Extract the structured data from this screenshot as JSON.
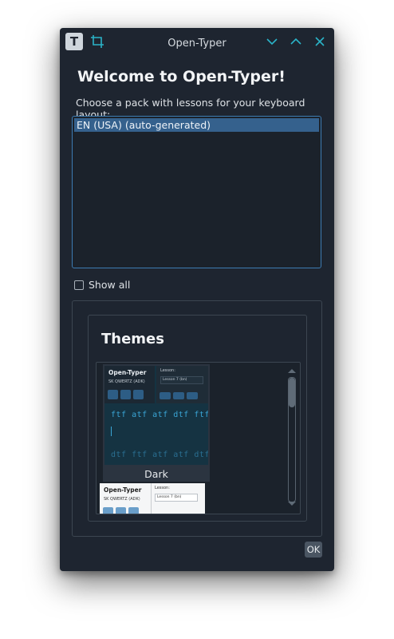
{
  "window": {
    "title": "Open-Typer",
    "app_icon_letter": "T"
  },
  "welcome": {
    "heading": "Welcome to Open-Typer!",
    "subtitle": "Choose a pack with lessons for your keyboard layout:"
  },
  "pack_list": {
    "items": [
      {
        "label": "EN (USA) (auto-generated)",
        "selected": true
      }
    ]
  },
  "show_all": {
    "label": "Show all",
    "checked": false
  },
  "themes": {
    "title": "Themes",
    "items": [
      {
        "label": "Dark",
        "preview": {
          "brand": "Open-Typer",
          "layout": "SK QWERTZ (ADK)",
          "lesson_label": "Lesson:",
          "lesson_value": "Lesson 7 (bn)",
          "text_line_1": "ftf atf atf dtf ftf a",
          "text_line_2": "dtf ftf atf atf dtf f"
        }
      },
      {
        "label": "",
        "preview": {
          "brand": "Open-Typer",
          "layout": "SK QWERTZ (ADK)",
          "lesson_label": "Lesson:",
          "lesson_value": "Lesson 7 (bn)"
        }
      }
    ]
  },
  "footer": {
    "ok_label": "OK"
  },
  "colors": {
    "accent": "#3d7cb3",
    "selection": "#35618d",
    "window_bg": "#1e2530",
    "title_icons": "#2ab3c8"
  }
}
